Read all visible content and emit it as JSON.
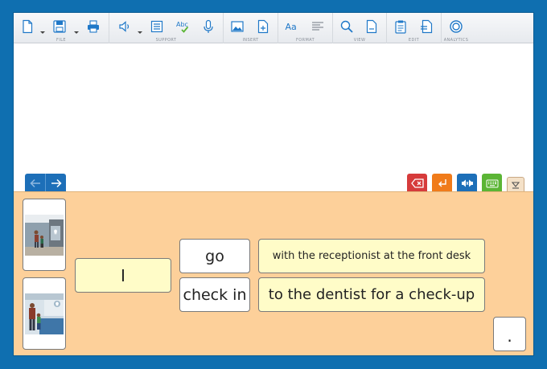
{
  "toolbar": {
    "groups": {
      "file": "FILE",
      "support": "SUPPORT",
      "insert": "INSERT",
      "format": "FORMAT",
      "view": "VIEW",
      "edit": "EDIT",
      "analytics": "ANALYTICS"
    },
    "icons": [
      "new-document-icon",
      "save-icon",
      "print-icon",
      "speaker-icon",
      "word-list-icon",
      "spell-check-icon",
      "microphone-icon",
      "insert-image-icon",
      "insert-file-icon",
      "font-icon",
      "paragraph-icon",
      "search-icon",
      "page-view-icon",
      "clipboard-icon",
      "edit-page-icon",
      "analytics-icon"
    ],
    "icon_color": "#1f78c8"
  },
  "colors": {
    "frame": "#0f6fb0",
    "panel": "#fdd09a",
    "tile_yellow": "#fffcc8",
    "nav_blue": "#1d6fb8",
    "delete_red": "#d63b3b",
    "enter_orange": "#f07b1a",
    "speak_blue": "#1d6fb8",
    "keyboard_green": "#5bb535",
    "collapse_beige": "#f4e1c8"
  },
  "sentence": {
    "subject": "I",
    "verbs": [
      "go",
      "check in"
    ],
    "phrases": [
      "with the receptionist at the front desk",
      "to the dentist for a check-up"
    ],
    "punctuation": "."
  }
}
